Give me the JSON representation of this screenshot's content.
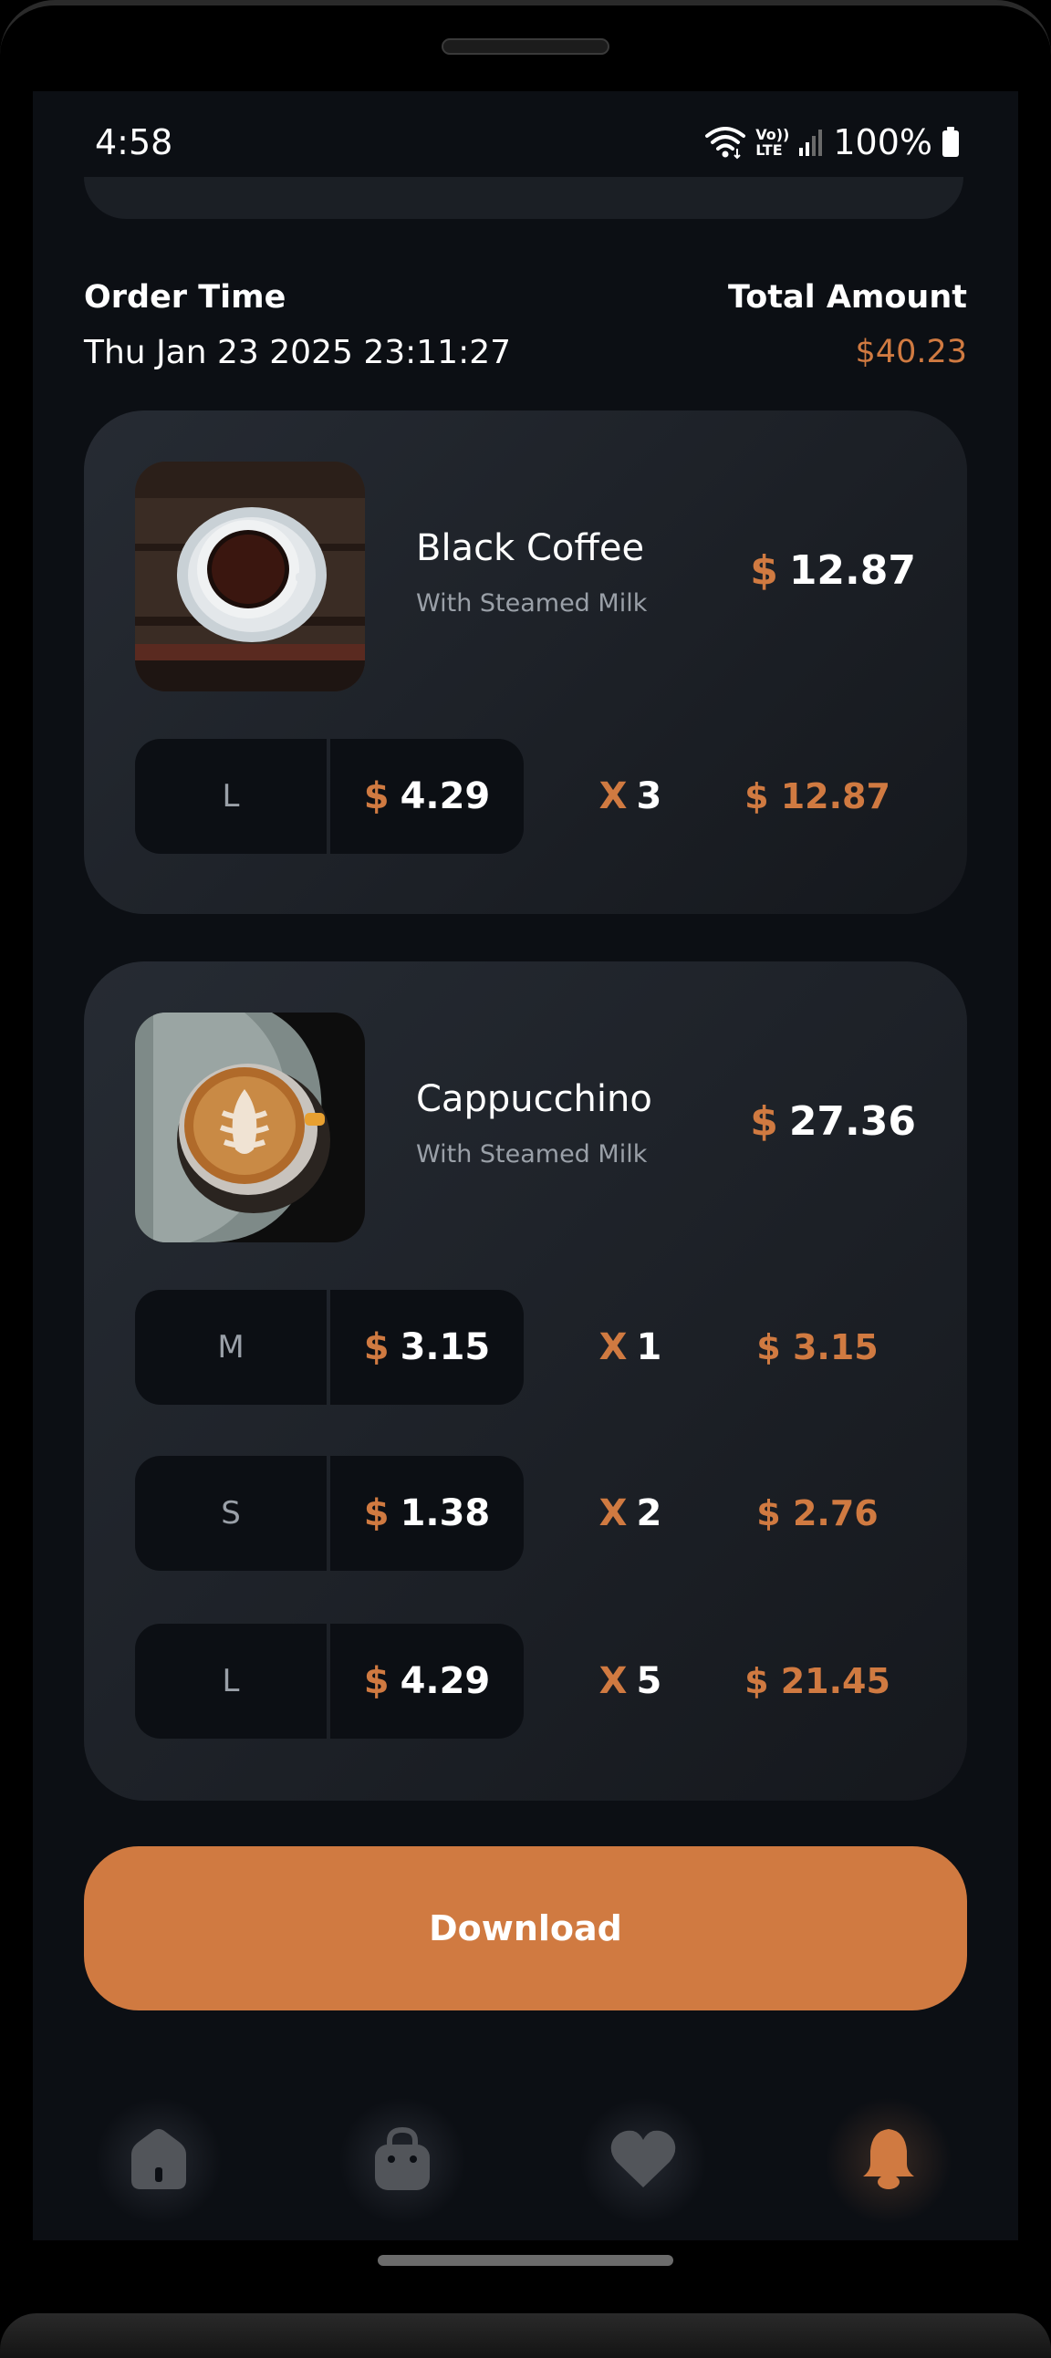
{
  "status_bar": {
    "time": "4:58",
    "network_label_top": "Vo))",
    "network_label_bottom": "LTE",
    "battery": "100%"
  },
  "order": {
    "time_label": "Order Time",
    "time_value": "Thu Jan 23 2025 23:11:27",
    "total_label": "Total Amount",
    "total_value": "$40.23"
  },
  "items": [
    {
      "name": "Black Coffee",
      "subtitle": "With Steamed Milk",
      "currency": "$",
      "price": "12.87",
      "sizes": [
        {
          "size": "L",
          "currency": "$",
          "unit_price": "4.29",
          "x": "X",
          "qty": "3",
          "line_total": "$ 12.87"
        }
      ]
    },
    {
      "name": "Cappucchino",
      "subtitle": "With Steamed Milk",
      "currency": "$",
      "price": "27.36",
      "sizes": [
        {
          "size": "M",
          "currency": "$",
          "unit_price": "3.15",
          "x": "X",
          "qty": "1",
          "line_total": "$ 3.15"
        },
        {
          "size": "S",
          "currency": "$",
          "unit_price": "1.38",
          "x": "X",
          "qty": "2",
          "line_total": "$ 2.76"
        },
        {
          "size": "L",
          "currency": "$",
          "unit_price": "4.29",
          "x": "X",
          "qty": "5",
          "line_total": "$ 21.45"
        }
      ]
    }
  ],
  "download_label": "Download",
  "nav": {
    "items": [
      {
        "icon": "home-icon",
        "active": false
      },
      {
        "icon": "bag-icon",
        "active": false
      },
      {
        "icon": "heart-icon",
        "active": false
      },
      {
        "icon": "bell-icon",
        "active": true
      }
    ]
  },
  "colors": {
    "accent": "#D07A41",
    "background": "#0C0F14",
    "card": "#21262E",
    "muted": "#9AA0A8",
    "nav_inactive": "#52555A"
  }
}
